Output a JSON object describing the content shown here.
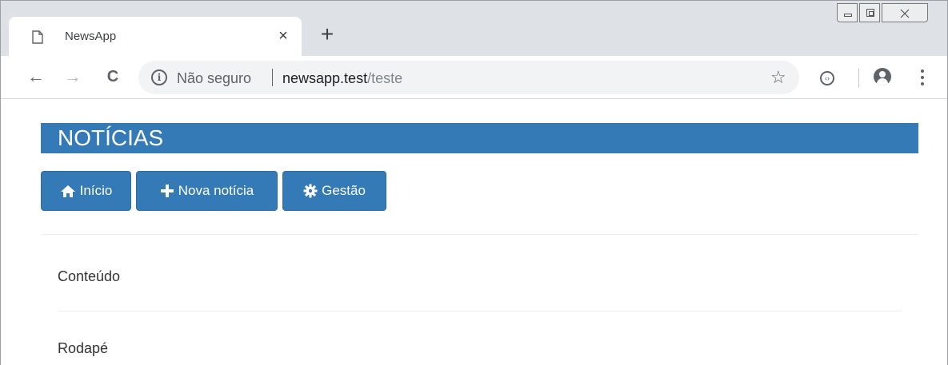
{
  "browser": {
    "tab": {
      "title": "NewsApp",
      "icon": "page-icon",
      "close_glyph": "×"
    },
    "new_tab_glyph": "+",
    "toolbar": {
      "back_glyph": "←",
      "forward_glyph": "→",
      "reload_glyph": "C",
      "security_label": "Não seguro",
      "url_host": "newsapp.test",
      "url_path": "/teste",
      "star_glyph": "☆"
    }
  },
  "page": {
    "header_title": "NOTÍCIAS",
    "nav_buttons": [
      {
        "label": "Início",
        "icon": "home-icon"
      },
      {
        "label": "Nova notícia",
        "icon": "plus-icon"
      },
      {
        "label": "Gestão",
        "icon": "gear-icon"
      }
    ],
    "content_label": "Conteúdo",
    "footer_label": "Rodapé"
  },
  "colors": {
    "primary": "#337ab7",
    "tabstrip": "#dee1e6",
    "omnibox": "#f1f3f4"
  }
}
